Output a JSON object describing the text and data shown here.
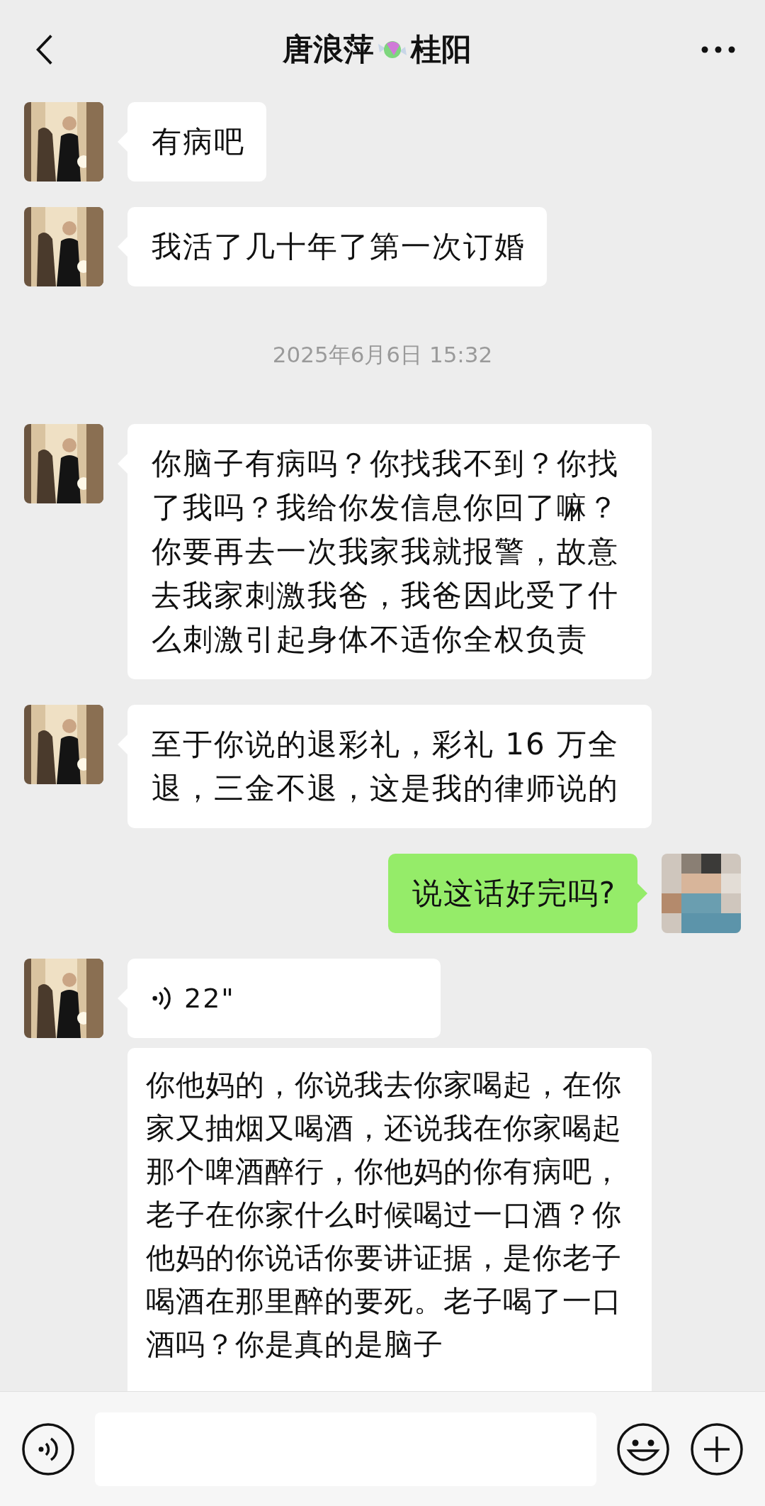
{
  "header": {
    "name": "唐浪萍",
    "suffix": "桂阳"
  },
  "messages": [
    {
      "kind": "text",
      "outgoing": false,
      "text": "有病吧"
    },
    {
      "kind": "text",
      "outgoing": false,
      "text": "我活了几十年了第一次订婚"
    },
    {
      "kind": "time",
      "text": "2025年6月6日 15:32"
    },
    {
      "kind": "text",
      "outgoing": false,
      "text": "你脑子有病吗？你找我不到？你找了我吗？我给你发信息你回了嘛？你要再去一次我家我就报警，故意去我家刺激我爸，我爸因此受了什么刺激引起身体不适你全权负责"
    },
    {
      "kind": "text",
      "outgoing": false,
      "text": "至于你说的退彩礼，彩礼 16 万全退，三金不退，这是我的律师说的"
    },
    {
      "kind": "text",
      "outgoing": true,
      "text": "说这话好完吗?"
    },
    {
      "kind": "voice",
      "outgoing": false,
      "text": "22\""
    },
    {
      "kind": "transcript",
      "outgoing": false,
      "text": "你他妈的，你说我去你家喝起，在你家又抽烟又喝酒，还说我在你家喝起那个啤酒醉行，你他妈的你有病吧，老子在你家什么时候喝过一口酒？你他妈的你说话你要讲证据，是你老子喝酒在那里醉的要死。老子喝了一口酒吗？你是真的是脑子"
    }
  ]
}
